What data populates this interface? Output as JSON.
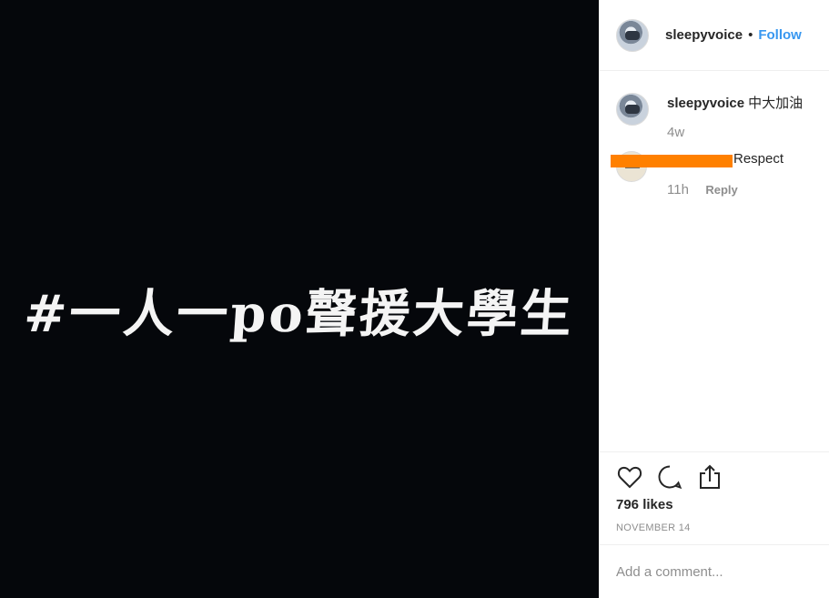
{
  "media": {
    "text": "#一人一po聲援大學生"
  },
  "header": {
    "username": "sleepyvoice",
    "separator": "•",
    "follow_label": "Follow"
  },
  "comments": [
    {
      "username": "sleepyvoice",
      "text": "中大加油",
      "time": "4w"
    },
    {
      "text": "Respect",
      "time": "11h",
      "reply_label": "Reply"
    }
  ],
  "likes": "796 likes",
  "date": "NOVEMBER 14",
  "comment_input": {
    "placeholder": "Add a comment..."
  },
  "colors": {
    "follow": "#3897f0",
    "redaction": "#ff8000",
    "media_bg": "#05070b",
    "muted": "#8e8e8e"
  }
}
